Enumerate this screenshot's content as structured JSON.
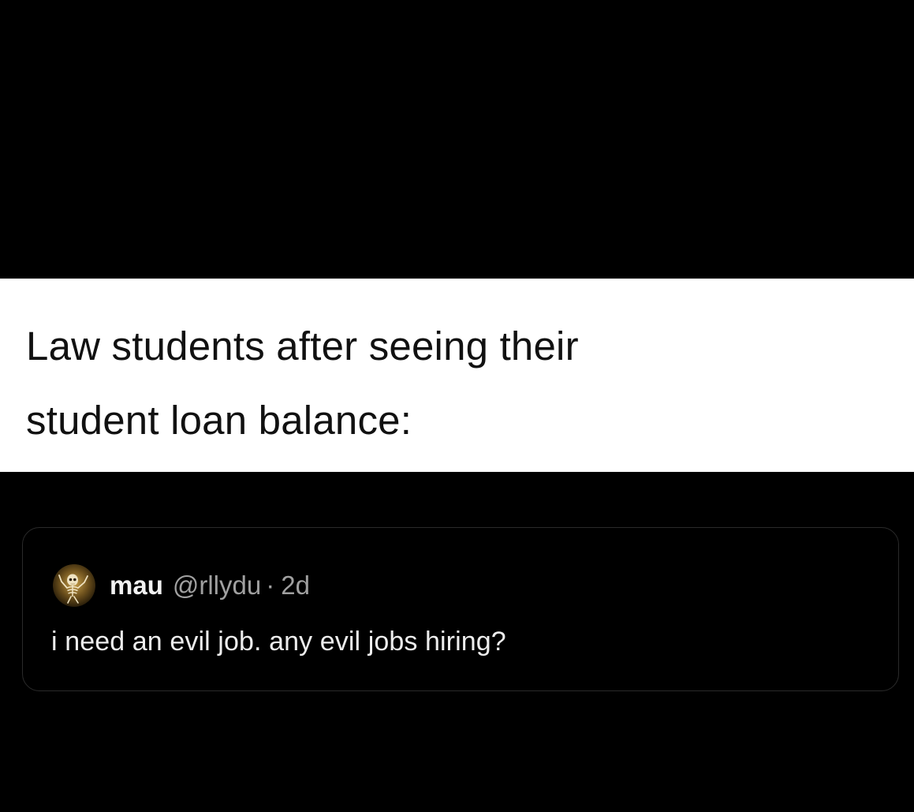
{
  "caption": {
    "line1": "Law students after seeing their",
    "line2": "student loan balance:"
  },
  "tweet": {
    "display_name": "mau",
    "handle": "@rllydu",
    "separator": "·",
    "time": "2d",
    "text": "i need an evil job. any evil jobs hiring?",
    "avatar_icon": "skeleton-avatar-icon"
  },
  "colors": {
    "background": "#000000",
    "caption_band": "#ffffff",
    "caption_text": "#111111",
    "tweet_text": "#ededed",
    "muted_text": "#a0a0a0",
    "card_border": "#2a2a2a"
  }
}
